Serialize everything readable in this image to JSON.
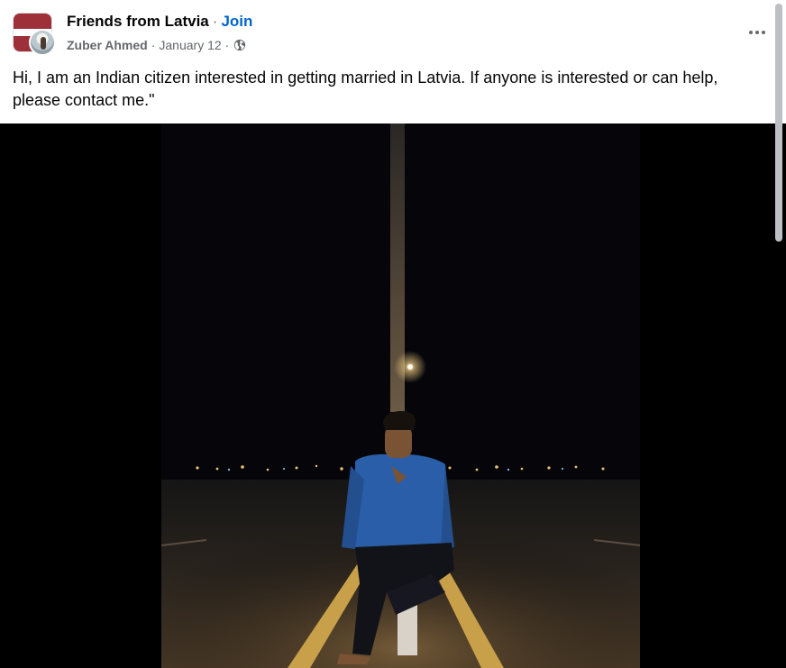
{
  "post": {
    "group_name": "Friends from Latvia",
    "separator": "·",
    "join_label": "Join",
    "author_name": "Zuber Ahmed",
    "date": "January 12",
    "privacy_icon": "globe-icon",
    "more_icon": "more-options-icon",
    "text": "Hi, I am an Indian citizen interested in getting married in Latvia. If anyone is interested or can help, please contact me.\"",
    "photo_description_icon": "photo"
  },
  "colors": {
    "link": "#0064d1",
    "secondary_text": "#65676b",
    "primary_text": "#050505",
    "flag_red": "#9e3039"
  }
}
